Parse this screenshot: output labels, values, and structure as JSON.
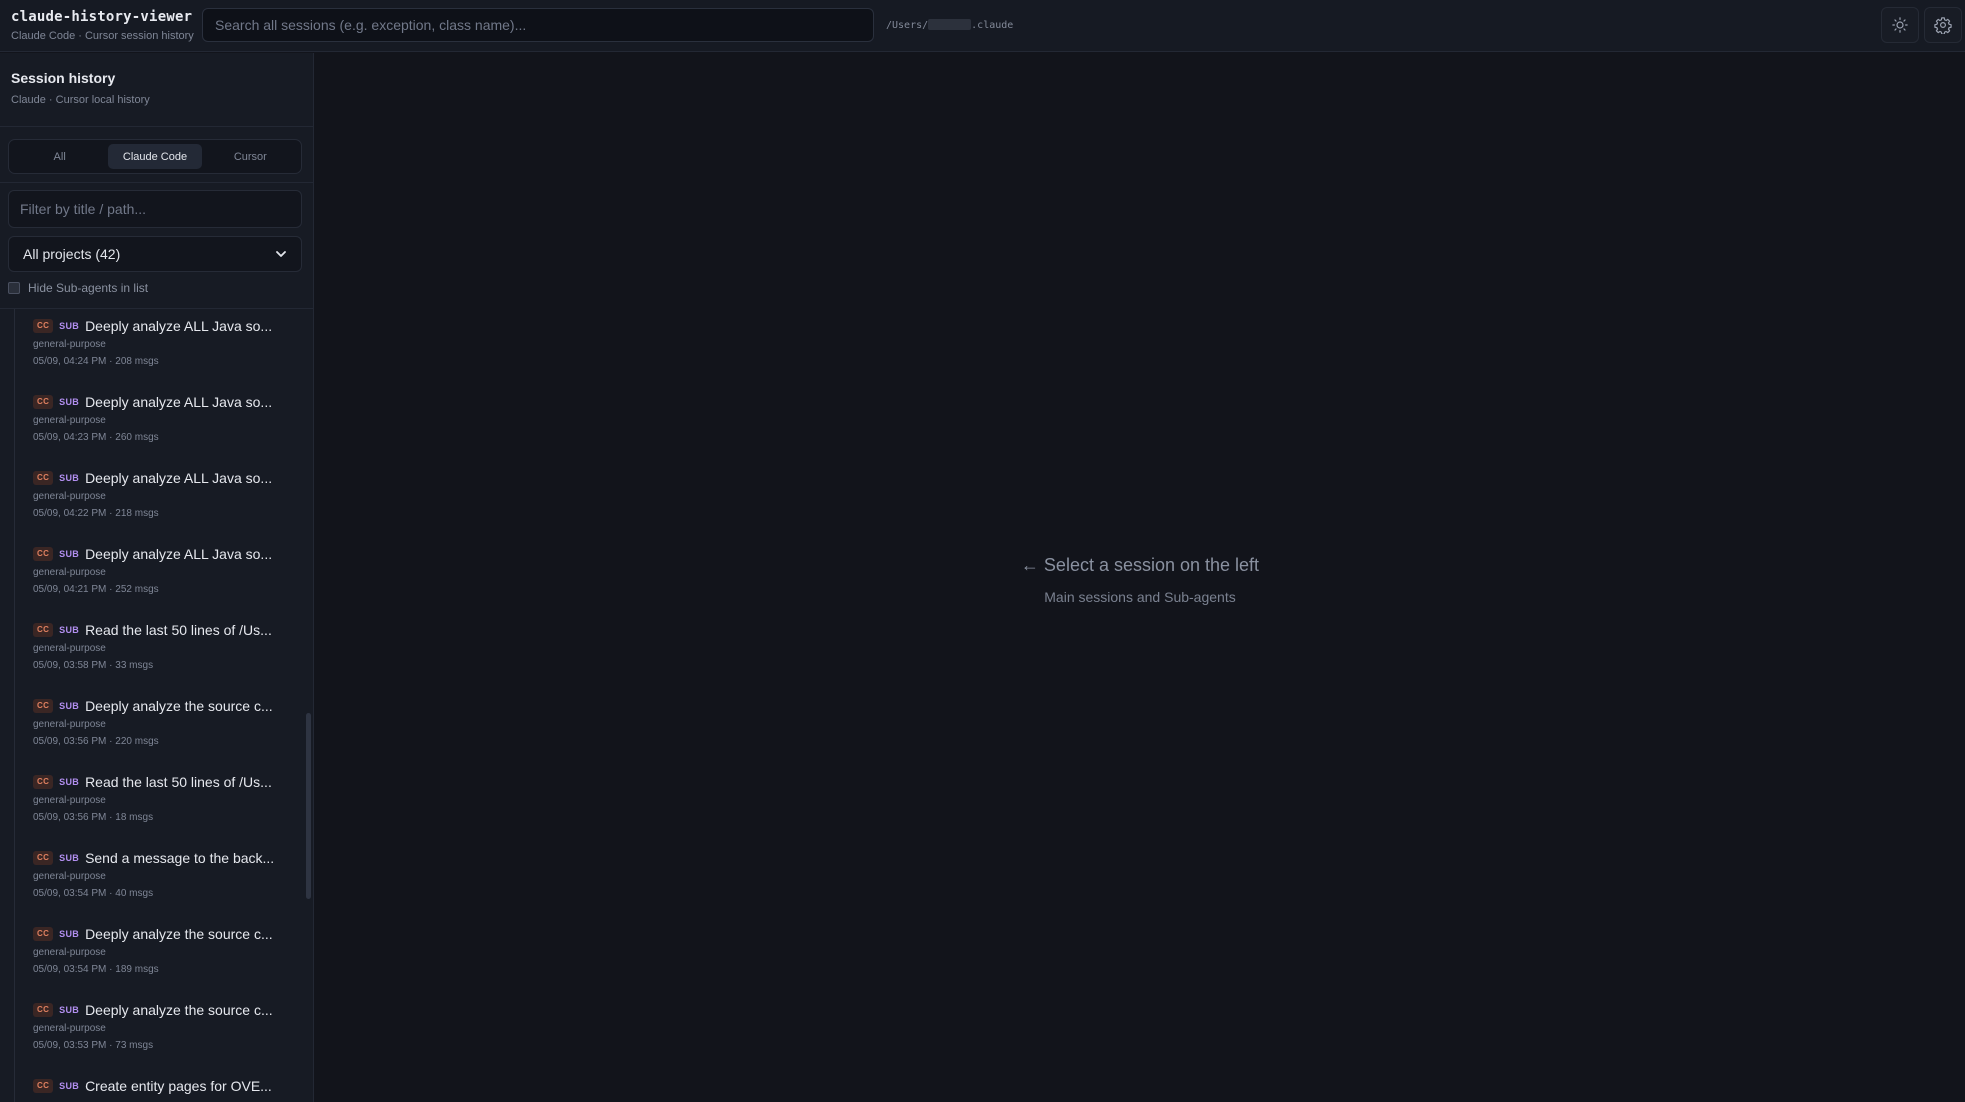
{
  "app": {
    "title": "claude-history-viewer",
    "subtitle": "Claude Code · Cursor session history"
  },
  "search": {
    "placeholder": "Search all sessions (e.g. exception, class name)...",
    "value": ""
  },
  "path": {
    "prefix": "/Users/",
    "suffix": ".claude"
  },
  "toolbar": {
    "theme_icon": "sun-icon",
    "settings_icon": "gear-icon"
  },
  "sidebar": {
    "title": "Session history",
    "subtitle": "Claude · Cursor local history",
    "tabs": [
      {
        "label": "All",
        "active": false
      },
      {
        "label": "Claude Code",
        "active": true
      },
      {
        "label": "Cursor",
        "active": false
      }
    ],
    "filter": {
      "placeholder": "Filter by title / path...",
      "value": ""
    },
    "project_select": {
      "selected": "All projects (42)"
    },
    "hide_subagents": {
      "label": "Hide Sub-agents in list",
      "checked": false
    },
    "badge_cc": "CC",
    "badge_sub": "SUB",
    "sessions": [
      {
        "title": "Deeply analyze ALL Java so...",
        "agent": "general-purpose",
        "meta": "05/09, 04:24 PM  · 208 msgs"
      },
      {
        "title": "Deeply analyze ALL Java so...",
        "agent": "general-purpose",
        "meta": "05/09, 04:23 PM  · 260 msgs"
      },
      {
        "title": "Deeply analyze ALL Java so...",
        "agent": "general-purpose",
        "meta": "05/09, 04:22 PM  · 218 msgs"
      },
      {
        "title": "Deeply analyze ALL Java so...",
        "agent": "general-purpose",
        "meta": "05/09, 04:21 PM  · 252 msgs"
      },
      {
        "title": "Read the last 50 lines of /Us...",
        "agent": "general-purpose",
        "meta": "05/09, 03:58 PM  · 33 msgs"
      },
      {
        "title": "Deeply analyze the source c...",
        "agent": "general-purpose",
        "meta": "05/09, 03:56 PM  · 220 msgs"
      },
      {
        "title": "Read the last 50 lines of /Us...",
        "agent": "general-purpose",
        "meta": "05/09, 03:56 PM  · 18 msgs"
      },
      {
        "title": "Send a message to the back...",
        "agent": "general-purpose",
        "meta": "05/09, 03:54 PM  · 40 msgs"
      },
      {
        "title": "Deeply analyze the source c...",
        "agent": "general-purpose",
        "meta": "05/09, 03:54 PM  · 189 msgs"
      },
      {
        "title": "Deeply analyze the source c...",
        "agent": "general-purpose",
        "meta": "05/09, 03:53 PM  · 73 msgs"
      },
      {
        "title": "Create entity pages for OVE...",
        "agent": "",
        "meta": ""
      }
    ]
  },
  "main": {
    "empty_title": "← Select a session on the left",
    "empty_subtitle": "Main sessions and Sub-agents"
  },
  "colors": {
    "background": "#12141b",
    "sidebar": "#171b24",
    "cc_badge": "#e08060",
    "sub_badge": "#b28ff0"
  }
}
